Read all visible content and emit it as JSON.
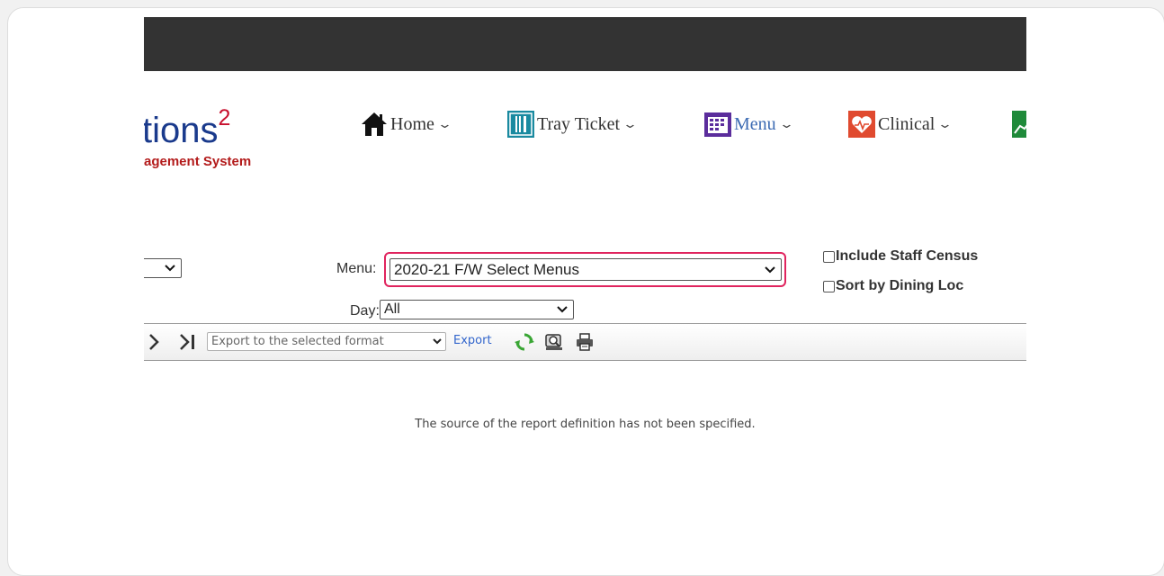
{
  "logo": {
    "main": "tions",
    "superscript": "2",
    "subtitle": "agement System"
  },
  "nav": {
    "home": {
      "label": "Home",
      "icon": "home-icon",
      "caret": "v"
    },
    "tray_ticket": {
      "label": "Tray Ticket",
      "icon": "fork-knife-icon",
      "caret": "v"
    },
    "menu": {
      "label": "Menu",
      "icon": "calendar-icon",
      "caret": "v"
    },
    "clinical": {
      "label": "Clinical",
      "icon": "heart-icon",
      "caret": "v"
    },
    "partial": {
      "icon": "chart-icon"
    }
  },
  "filters": {
    "menu_label": "Menu:",
    "menu_value": "2020-21 F/W Select Menus",
    "day_label": "Day:",
    "day_value": "All",
    "include_staff_census": "Include Staff Census",
    "sort_by_dining_loc": "Sort by Dining Loc"
  },
  "toolbar": {
    "export_format": "Export to the selected format",
    "export_label": "Export"
  },
  "report": {
    "message": "The source of the report definition has not been specified."
  },
  "colors": {
    "highlight": "#e0245e",
    "topbar": "#333333",
    "link": "#3366cc"
  }
}
